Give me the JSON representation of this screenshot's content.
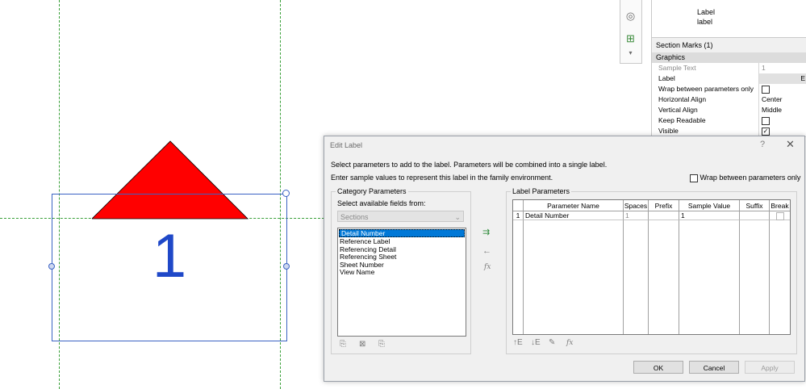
{
  "canvas": {
    "tag_number": "1"
  },
  "properties": {
    "type_label": "Label",
    "type_sublabel": "label",
    "selector": "Section Marks (1)",
    "group": "Graphics",
    "rows": [
      {
        "name": "Sample Text",
        "value": "1",
        "greyed": true
      },
      {
        "name": "Label",
        "value": "E",
        "button": true
      },
      {
        "name": "Wrap between parameters only",
        "value": "",
        "checkbox": false
      },
      {
        "name": "Horizontal Align",
        "value": "Center"
      },
      {
        "name": "Vertical Align",
        "value": "Middle"
      },
      {
        "name": "Keep Readable",
        "value": "",
        "checkbox": false
      },
      {
        "name": "Visible",
        "value": "",
        "checkbox": true
      }
    ]
  },
  "dialog": {
    "title": "Edit Label",
    "help": "?",
    "close": "✕",
    "instruction1": "Select parameters to add to the label.  Parameters will be combined into a single label.",
    "instruction2": "Enter sample values to represent this label in the family environment.",
    "wrap_label": "Wrap between parameters only",
    "category_group": "Category Parameters",
    "fields_label": "Select available fields from:",
    "category_select": "Sections",
    "fields": [
      "Detail Number",
      "Reference Label",
      "Referencing Detail",
      "Referencing Sheet",
      "Sheet Number",
      "View Name"
    ],
    "label_group": "Label Parameters",
    "columns": [
      "Parameter Name",
      "Spaces",
      "Prefix",
      "Sample Value",
      "Suffix",
      "Break"
    ],
    "rows": [
      {
        "num": "1",
        "name": "Detail Number",
        "spaces": "1",
        "prefix": "",
        "sample": "1",
        "suffix": ""
      }
    ],
    "ok": "OK",
    "cancel": "Cancel",
    "apply": "Apply"
  }
}
